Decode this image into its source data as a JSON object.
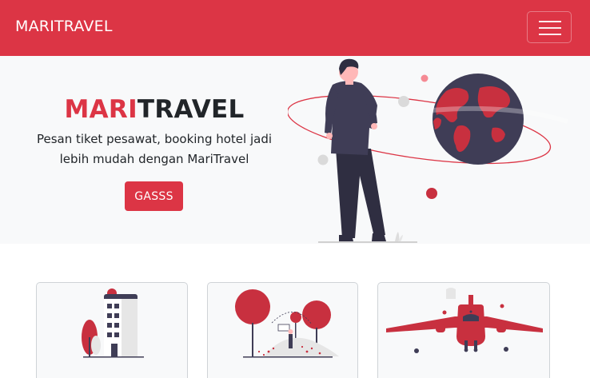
{
  "navbar": {
    "brand": "MARITRAVEL",
    "menu_icon": "hamburger-menu-icon"
  },
  "hero": {
    "title_accent": "MARI",
    "title_rest": "TRAVEL",
    "description": "Pesan tiket pesawat, booking hotel jadi lebih mudah dengan MariTravel",
    "cta_label": "GASSS",
    "illustration": "traveler-globe-illustration"
  },
  "cards": [
    {
      "illustration": "hotel-building-illustration"
    },
    {
      "illustration": "park-scene-illustration"
    },
    {
      "illustration": "airplane-illustration"
    }
  ],
  "colors": {
    "primary": "#dc3545",
    "light_bg": "#f8f9fa",
    "dark_figure": "#3f3d56",
    "text": "#212529"
  }
}
